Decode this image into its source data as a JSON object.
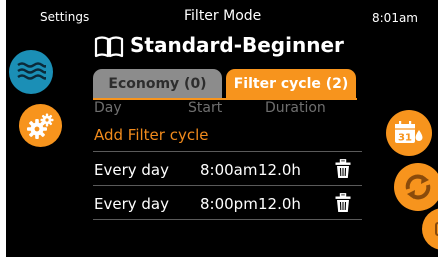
{
  "status_bar": {
    "settings_label": "Settings",
    "title": "Filter Mode",
    "time": "8:01am"
  },
  "header": {
    "icon": "book-icon",
    "title": "Standard-Beginner"
  },
  "tabs": [
    {
      "label": "Economy (0)",
      "active": false
    },
    {
      "label": "Filter cycle (2)",
      "active": true
    }
  ],
  "table": {
    "columns": [
      "Day",
      "Start",
      "Duration"
    ],
    "add_label": "Add Filter cycle",
    "rows": [
      {
        "day": "Every day",
        "start": "8:00am",
        "duration": "12.0h",
        "action_icon": "trash-icon"
      },
      {
        "day": "Every day",
        "start": "8:00pm",
        "duration": "12.0h",
        "action_icon": "trash-icon"
      }
    ]
  },
  "left_buttons": [
    {
      "icon": "water-waves-icon",
      "color": "#1b8fb6"
    },
    {
      "icon": "gears-icon",
      "color": "#f7941d"
    }
  ],
  "right_buttons": [
    {
      "icon": "calendar-31-icon",
      "color": "#f7941d"
    },
    {
      "icon": "refresh-arrows-icon",
      "color": "#f7941d"
    },
    {
      "icon": "partial-orange-icon",
      "color": "#f7941d"
    }
  ],
  "colors": {
    "accent": "#f7941d",
    "tab_inactive": "#8c8c8c",
    "blue": "#1b8fb6",
    "background": "#000000"
  }
}
